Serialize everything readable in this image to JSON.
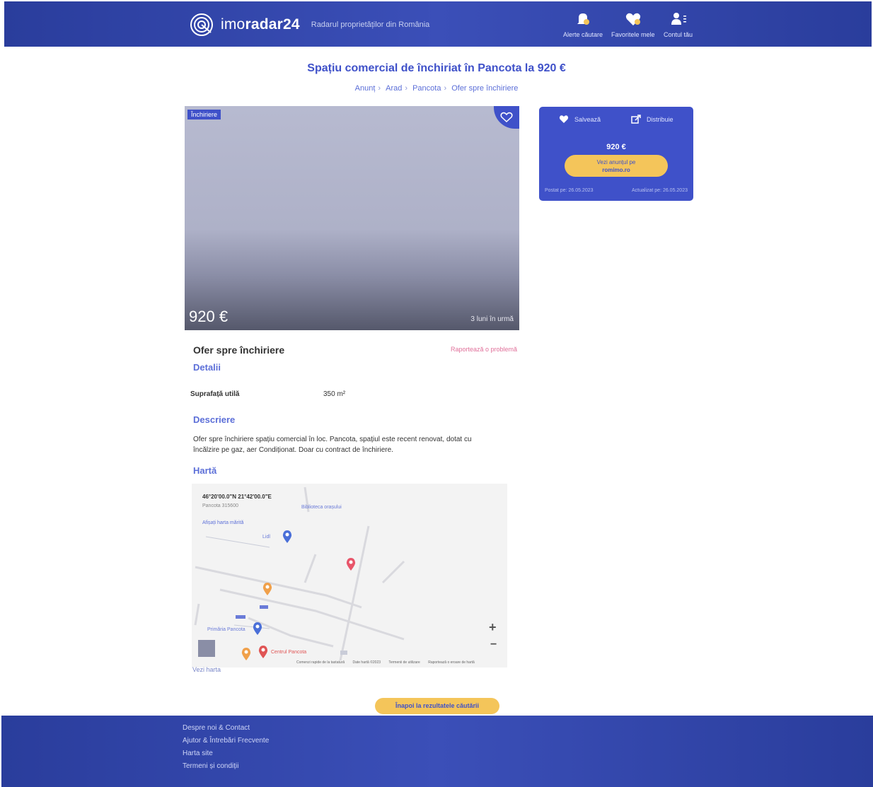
{
  "header": {
    "brand_light": "imo",
    "brand_bold": "radar24",
    "tagline": "Radarul proprietăților din România",
    "actions": [
      {
        "label": "Alerte căutare",
        "icon": "bell-icon"
      },
      {
        "label": "Favoritele mele",
        "icon": "heart-icon"
      },
      {
        "label": "Contul tău",
        "icon": "user-icon"
      }
    ]
  },
  "page": {
    "title": "Spațiu comercial de închiriat în Pancota la 920 €",
    "breadcrumb": [
      "Anunț",
      "Arad",
      "Pancota",
      "Ofer spre închiriere"
    ]
  },
  "photo": {
    "badge": "Închiriere",
    "price": "920 €",
    "posted": "3 luni în urmă"
  },
  "details": {
    "ad_title": "Ofer spre închiriere",
    "report_link": "Raportează o problemă",
    "details_heading": "Detalii",
    "specs": [
      {
        "label": "Suprafață utilă",
        "value": "350 m²"
      }
    ],
    "description_heading": "Descriere",
    "description": "Ofer spre închiriere spațiu comercial în loc. Pancota, spațiul este recent renovat, dotat cu încălzire pe gaz, aer Condiționat. Doar cu contract de închiriere.",
    "map_heading": "Hartă",
    "see_map": "Vezi harta"
  },
  "map": {
    "coords": "46°20'00.0\"N 21°42'00.0\"E",
    "sub": "Pancota 315600",
    "link": "Afișați harta mărită",
    "labels": [
      "Biblioteca orașului",
      "Lidl",
      "Primăria Pancota",
      "Centrul Pancota"
    ],
    "footer": [
      "Comenzi rapide de la tastatură",
      "Date hartă ©2023",
      "Termenii de utilizare",
      "Raportează o eroare de hartă"
    ]
  },
  "panel": {
    "save": "Salvează",
    "share": "Distribuie",
    "price": "920 €",
    "cta_line1": "Vezi anunțul pe",
    "cta_line2": "romimo.ro",
    "date_added": "Postat pe: 26.05.2023",
    "date_updated": "Actualizat pe: 26.05.2023"
  },
  "back_button": "Înapoi la rezultatele căutării",
  "footer": {
    "links": [
      "Despre noi & Contact",
      "Ajutor & Întrebări Frecvente",
      "Harta site",
      "Termeni și condiții"
    ]
  },
  "colors": {
    "brand": "#3f51c9",
    "accent": "#f4c55a",
    "report": "#e0709a"
  }
}
